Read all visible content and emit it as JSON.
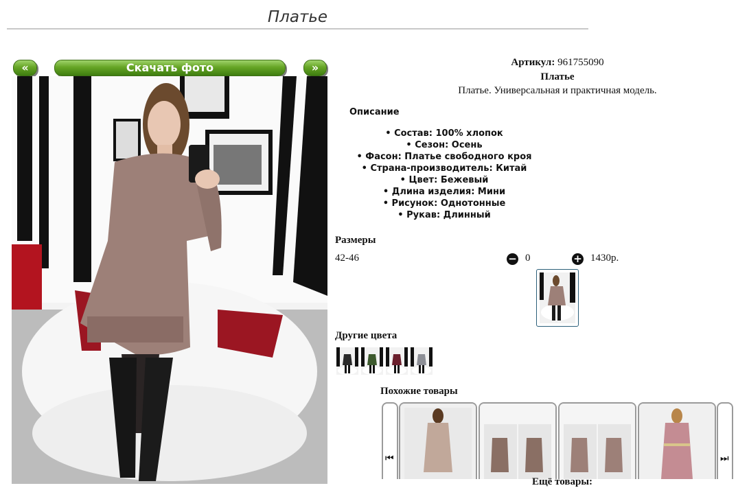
{
  "page": {
    "title": "Платье"
  },
  "nav": {
    "prev": "«",
    "download": "Скачать фото",
    "next": "»"
  },
  "product": {
    "article_label": "Артикул:",
    "article_value": "961755090",
    "name": "Платье",
    "tagline": "Платье. Универсальная и практичная модель.",
    "description_title": "Описание",
    "features": [
      "Состав: 100% хлопок",
      "Сезон: Осень",
      "Фасон: Платье свободного кроя",
      "Страна-производитель: Китай",
      "Цвет: Бежевый",
      "Длина изделия: Мини",
      "Рисунок: Однотонные",
      "Рукав: Длинный"
    ],
    "sizes_title": "Размеры",
    "size": "42-46",
    "quantity": "0",
    "price": "1430р."
  },
  "other_colors": {
    "title": "Другие цвета",
    "swatches": [
      "#2a2a2a",
      "#3d5a2e",
      "#6a1f2c",
      "#8d8f96"
    ]
  },
  "similar": {
    "title": "Похожие товары",
    "more": "Ещё товары:"
  },
  "icons": {
    "prev": "prev-arrow-icon",
    "next": "next-arrow-icon",
    "minus": "minus-circle-icon",
    "plus": "plus-circle-icon"
  },
  "colors": {
    "button_green": "#66a525",
    "dress": "#9d8078",
    "border": "#2b5f7a"
  }
}
